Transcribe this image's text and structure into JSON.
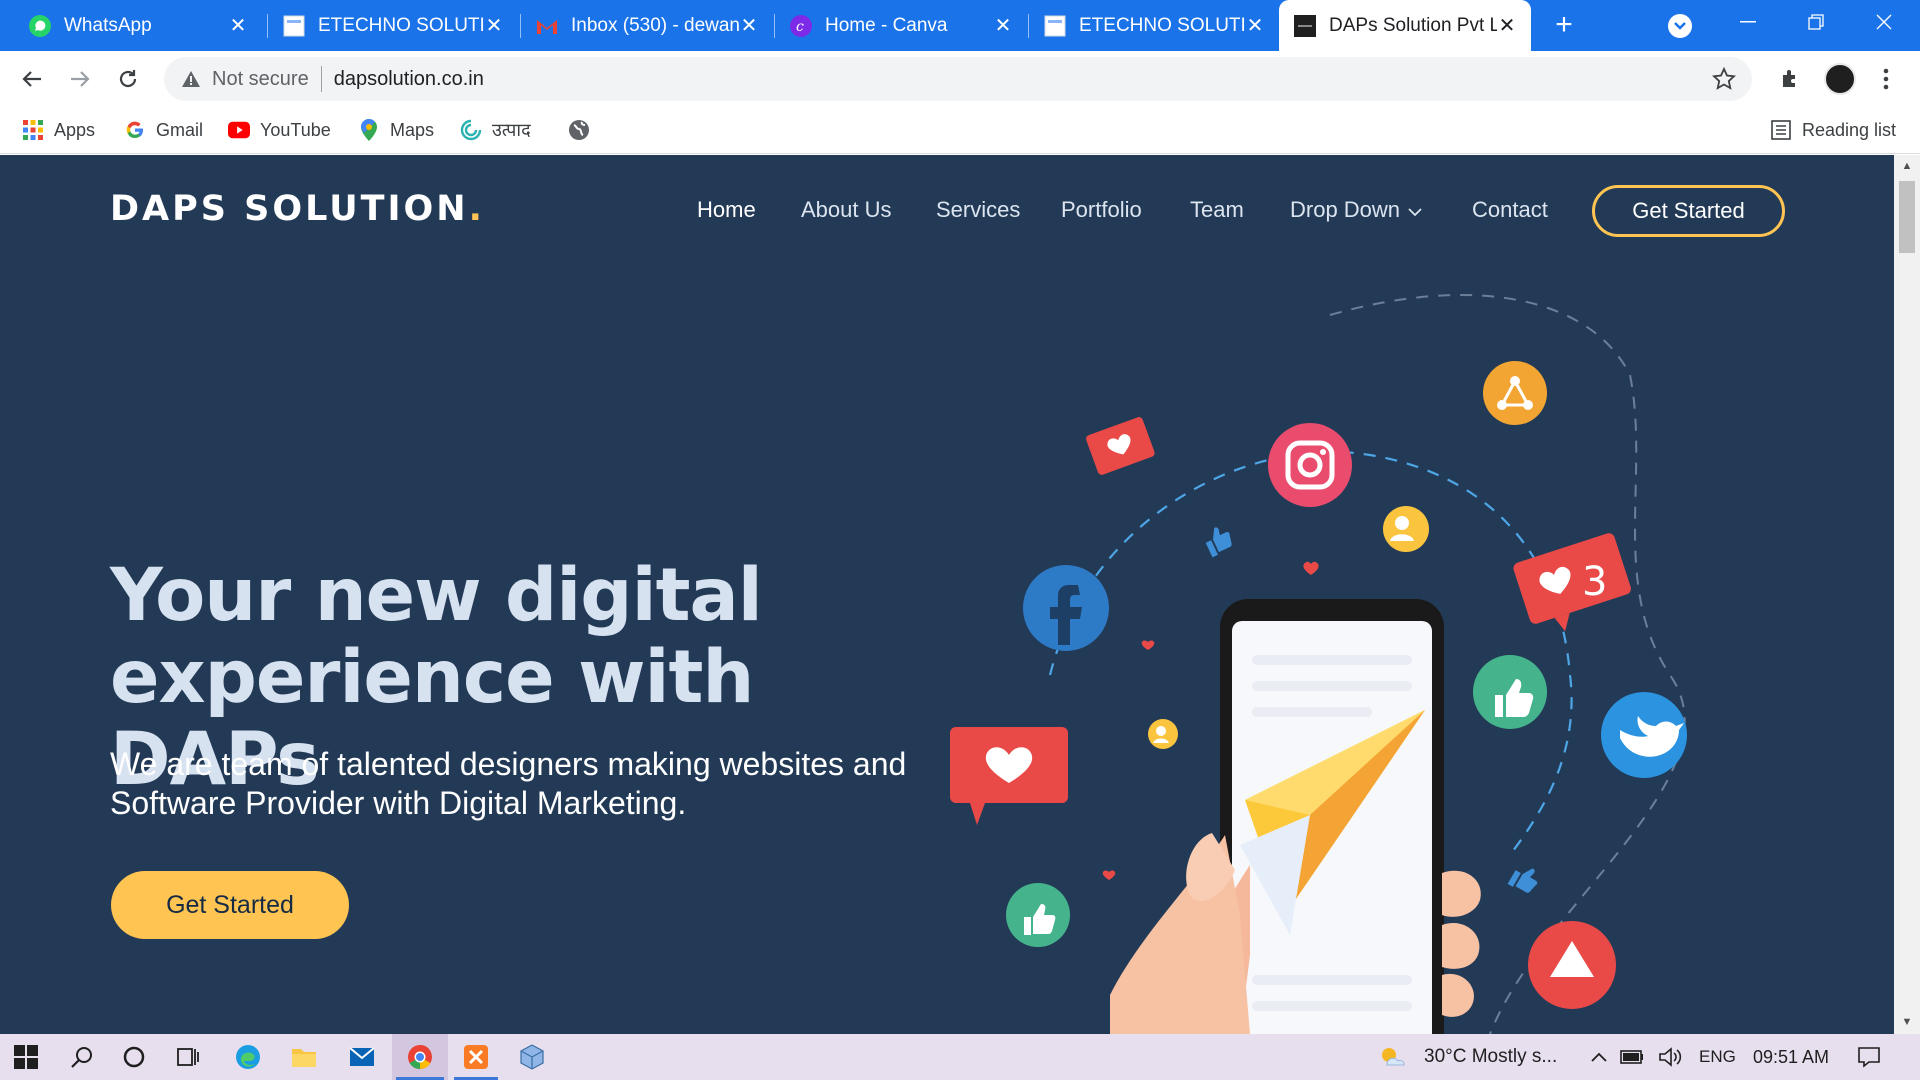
{
  "browser": {
    "tabs": [
      {
        "title": "WhatsApp",
        "icon": "whatsapp-icon",
        "active": false
      },
      {
        "title": "ETECHNO SOLUTIO",
        "icon": "page-icon",
        "active": false
      },
      {
        "title": "Inbox (530) - dewan",
        "icon": "gmail-icon",
        "active": false
      },
      {
        "title": "Home - Canva",
        "icon": "canva-icon",
        "active": false
      },
      {
        "title": "ETECHNO SOLUTIO",
        "icon": "page-icon",
        "active": false
      },
      {
        "title": "DAPs Solution Pvt L",
        "icon": "daps-icon",
        "active": true
      }
    ],
    "address": {
      "security_label": "Not secure",
      "url": "dapsolution.co.in"
    },
    "bookmarks": [
      {
        "label": "Apps",
        "icon": "apps-grid-icon"
      },
      {
        "label": "Gmail",
        "icon": "google-g-icon"
      },
      {
        "label": "YouTube",
        "icon": "youtube-icon"
      },
      {
        "label": "Maps",
        "icon": "maps-pin-icon"
      },
      {
        "label": "उत्पाद",
        "icon": "product-icon"
      },
      {
        "label": "",
        "icon": "globe-icon"
      }
    ],
    "reading_list": "Reading list"
  },
  "site": {
    "logo": {
      "text": "DAPS SOLUTION",
      "dot": "."
    },
    "nav": [
      {
        "label": "Home",
        "active": true
      },
      {
        "label": "About Us"
      },
      {
        "label": "Services"
      },
      {
        "label": "Portfolio"
      },
      {
        "label": "Team"
      },
      {
        "label": "Drop Down"
      },
      {
        "label": "Contact"
      }
    ],
    "header_cta": "Get Started",
    "hero": {
      "title_line1": "Your new digital",
      "title_line2": "experience with DAPs",
      "subtitle": "We are team of talented designers making websites and Software Provider with Digital Marketing.",
      "cta": "Get Started"
    },
    "illustration": {
      "notification_count": "3"
    },
    "colors": {
      "background": "#233a57",
      "accent": "#ffc451"
    }
  },
  "taskbar": {
    "weather": "30°C  Mostly s...",
    "language": "ENG",
    "time": "09:51 AM"
  }
}
